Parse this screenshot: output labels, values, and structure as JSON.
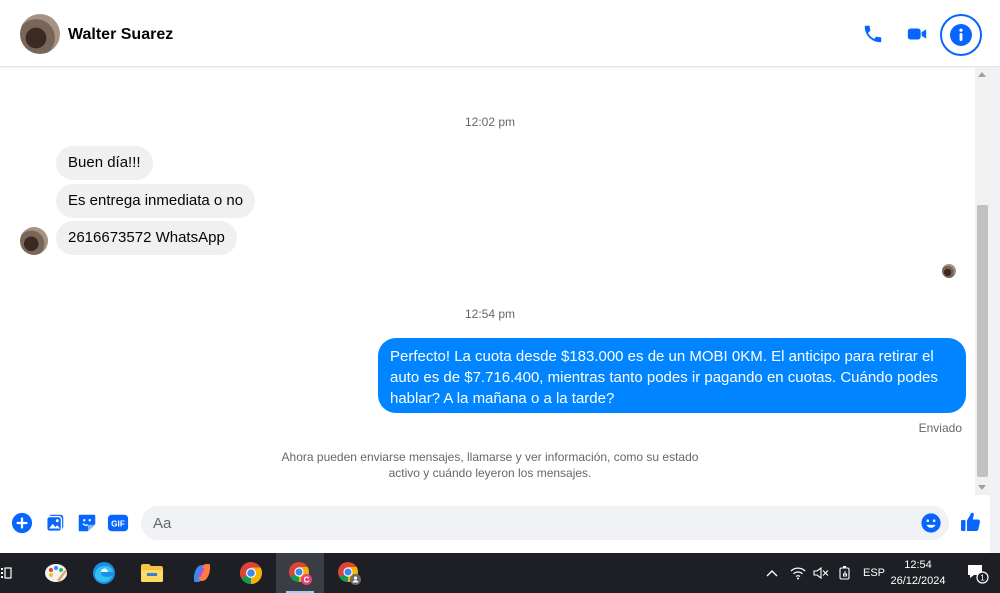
{
  "header": {
    "contact_name": "Walter Suarez",
    "actions": [
      "phone-icon",
      "video-camera-icon",
      "info-icon"
    ]
  },
  "messages": {
    "time_1": "12:02 pm",
    "incoming": [
      "Buen día!!!",
      "Es entrega inmediata o no",
      "2616673572 WhatsApp"
    ],
    "time_2": "12:54 pm",
    "outgoing": "Perfecto! La cuota desde $183.000 es de un MOBI 0KM. El anticipo para retirar el auto es de $7.716.400, mientras tanto podes ir pagando en cuotas. Cuándo podes hablar? A la mañana o a la tarde?",
    "outgoing_status": "Enviado",
    "system_note": "Ahora pueden enviarse mensajes, llamarse y ver información, como su estado activo y cuándo leyeron los mensajes."
  },
  "composer": {
    "placeholder": "Aa",
    "buttons": [
      "plus-icon",
      "image-icon",
      "sticker-icon",
      "gif-icon",
      "emoji-icon",
      "thumbs-up-icon"
    ],
    "gif_label": "GIF"
  },
  "taskbar": {
    "language": "ESP",
    "time": "12:54",
    "date": "26/12/2024",
    "notification_count": "1",
    "chrome_badge_letter": "C"
  },
  "colors": {
    "accent": "#0866ff",
    "outgoing_bubble": "#0084ff",
    "incoming_bubble": "#f0f0f0"
  }
}
